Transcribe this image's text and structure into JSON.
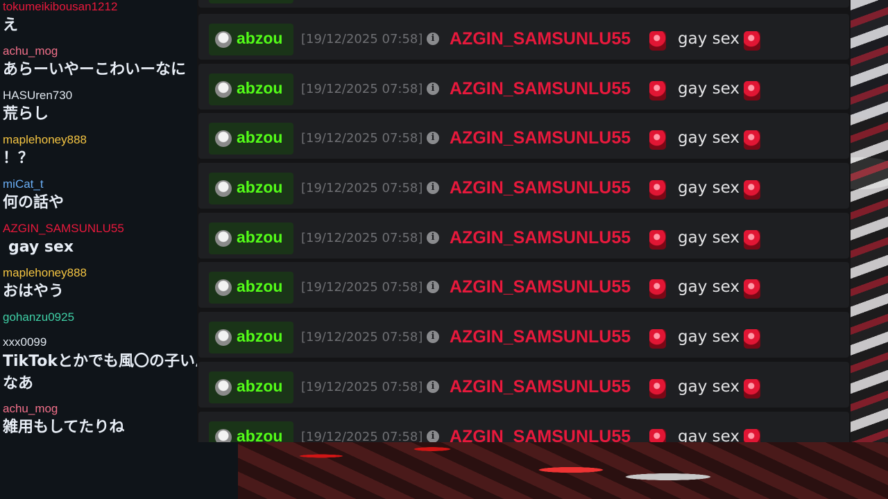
{
  "comments": [
    {
      "user": "tokumeikibousan1212",
      "color": "#e8193c",
      "text": "え"
    },
    {
      "user": "achu_mog",
      "color": "#f2708a",
      "text": "あらーいやーこわいーなに"
    },
    {
      "user": "HASUren730",
      "color": "#dfe6ee",
      "text": "荒らし"
    },
    {
      "user": "maplehoney888",
      "color": "#f5c542",
      "text": "！？"
    },
    {
      "user": "miCat_t",
      "color": "#6aaef5",
      "text": "何の話や"
    },
    {
      "user": "AZGIN_SAMSUNLU55",
      "color": "#e8193c",
      "text": "gay sex"
    },
    {
      "user": "maplehoney888",
      "color": "#f5c542",
      "text": "おはやう"
    },
    {
      "user": "gohanzu0925",
      "color": "#3fd0a6",
      "text": ""
    },
    {
      "user": "xxx0099",
      "color": "#dfe6ee",
      "text": "TikTokとかでも風〇の子いんなあ"
    },
    {
      "user": "achu_mog",
      "color": "#f2708a",
      "text": "雑用もしてたりね"
    }
  ],
  "chat_messages": [
    {
      "badge_user": "abzou",
      "timestamp": "[19/12/2025 07:58]",
      "username": "AZGIN_SAMSUNLU55",
      "text": "gay sex"
    },
    {
      "badge_user": "abzou",
      "timestamp": "[19/12/2025 07:58]",
      "username": "AZGIN_SAMSUNLU55",
      "text": "gay sex"
    },
    {
      "badge_user": "abzou",
      "timestamp": "[19/12/2025 07:58]",
      "username": "AZGIN_SAMSUNLU55",
      "text": "gay sex"
    },
    {
      "badge_user": "abzou",
      "timestamp": "[19/12/2025 07:58]",
      "username": "AZGIN_SAMSUNLU55",
      "text": "gay sex"
    },
    {
      "badge_user": "abzou",
      "timestamp": "[19/12/2025 07:58]",
      "username": "AZGIN_SAMSUNLU55",
      "text": "gay sex"
    },
    {
      "badge_user": "abzou",
      "timestamp": "[19/12/2025 07:58]",
      "username": "AZGIN_SAMSUNLU55",
      "text": "gay sex"
    },
    {
      "badge_user": "abzou",
      "timestamp": "[19/12/2025 07:58]",
      "username": "AZGIN_SAMSUNLU55",
      "text": "gay sex"
    },
    {
      "badge_user": "abzou",
      "timestamp": "[19/12/2025 07:58]",
      "username": "AZGIN_SAMSUNLU55",
      "text": "gay sex"
    },
    {
      "badge_user": "abzou",
      "timestamp": "[19/12/2025 07:58]",
      "username": "AZGIN_SAMSUNLU55",
      "text": "gay sex"
    }
  ],
  "icons": {
    "info": "info-icon",
    "avatar": "avatar",
    "emote": "red-emote-icon"
  },
  "colors": {
    "badge_green": "#53fc18",
    "username_red": "#e8193c",
    "panel_bg": "#1e1f22",
    "comment_bg": "#0f1419"
  }
}
